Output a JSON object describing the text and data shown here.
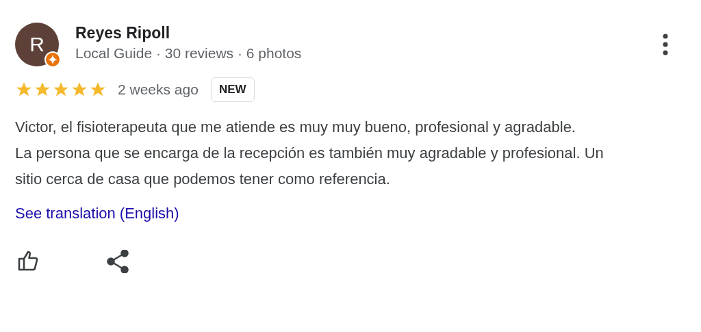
{
  "reviewer": {
    "initial": "R",
    "name": "Reyes Ripoll",
    "meta": "Local Guide · 30 reviews · 6 photos",
    "local_guide": true
  },
  "review": {
    "stars": 5,
    "time": "2 weeks ago",
    "badge": "NEW",
    "paragraphs": [
      "Victor, el fisioterapeuta que me atiende es muy muy bueno, profesional y agradable.",
      "La persona que se encarga de la recepción es también muy agradable y profesional. Un sitio cerca de casa que podemos tener como referencia."
    ],
    "translation_link": "See translation (English)"
  }
}
